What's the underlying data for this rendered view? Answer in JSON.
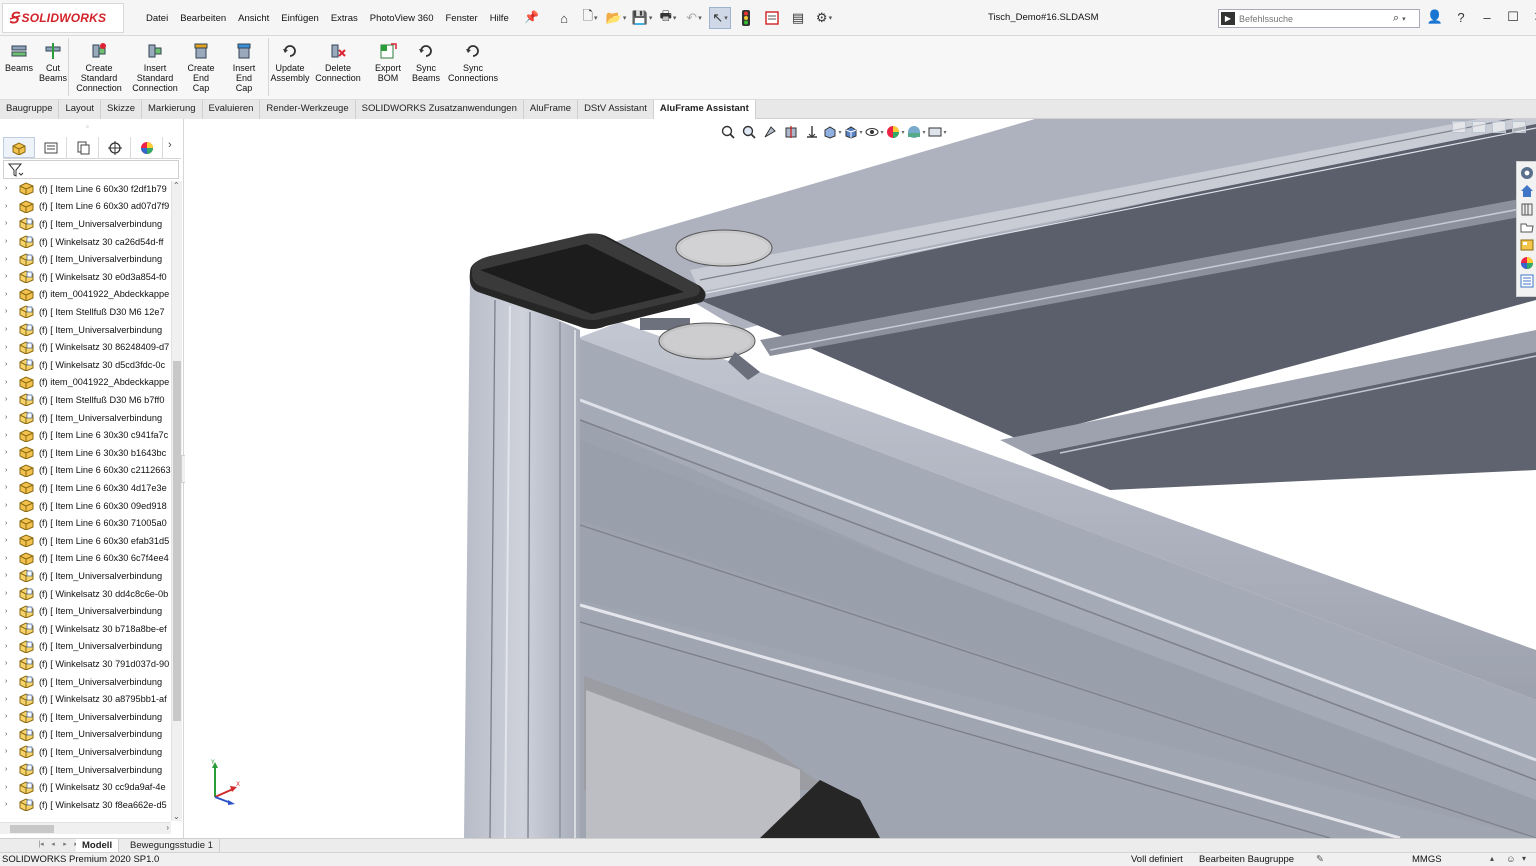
{
  "app": {
    "logo_brand": "SOLIDWORKS",
    "document_title": "Tisch_Demo#16.SLDASM"
  },
  "menu": [
    "Datei",
    "Bearbeiten",
    "Ansicht",
    "Einfügen",
    "Extras",
    "PhotoView 360",
    "Fenster",
    "Hilfe"
  ],
  "search": {
    "placeholder": "Befehlssuche"
  },
  "ribbon": [
    {
      "label": "Beams",
      "icon": "beams-icon"
    },
    {
      "label": "Cut\nBeams",
      "icon": "cut-beams-icon"
    },
    {
      "label": "Create\nStandard\nConnection",
      "icon": "create-connection-icon"
    },
    {
      "label": "Insert\nStandard\nConnection",
      "icon": "insert-connection-icon"
    },
    {
      "label": "Create\nEnd Cap",
      "icon": "create-end-cap-icon"
    },
    {
      "label": "Insert\nEnd Cap",
      "icon": "insert-end-cap-icon"
    },
    {
      "label": "Update\nAssembly",
      "icon": "update-assembly-icon"
    },
    {
      "label": "Delete\nConnection",
      "icon": "delete-connection-icon"
    },
    {
      "label": "Export\nBOM",
      "icon": "export-bom-icon"
    },
    {
      "label": "Sync\nBeams",
      "icon": "sync-beams-icon"
    },
    {
      "label": "Sync\nConnections",
      "icon": "sync-connections-icon"
    }
  ],
  "tabs": [
    {
      "label": "Baugruppe",
      "active": false
    },
    {
      "label": "Layout",
      "active": false
    },
    {
      "label": "Skizze",
      "active": false
    },
    {
      "label": "Markierung",
      "active": false
    },
    {
      "label": "Evaluieren",
      "active": false
    },
    {
      "label": "Render-Werkzeuge",
      "active": false
    },
    {
      "label": "SOLIDWORKS Zusatzanwendungen",
      "active": false
    },
    {
      "label": "AluFrame",
      "active": false
    },
    {
      "label": "DStV Assistant",
      "active": false
    },
    {
      "label": "AluFrame Assistant",
      "active": true
    }
  ],
  "tree": {
    "items": [
      {
        "label": "(f) [ Item Line 6 60x30 f2df1b79",
        "kind": "assembly"
      },
      {
        "label": "(f) [ Item Line 6 60x30 ad07d7f9",
        "kind": "assembly"
      },
      {
        "label": "(f) [ Item_Universalverbindung",
        "kind": "part"
      },
      {
        "label": "(f) [ Winkelsatz 30 ca26d54d-ff",
        "kind": "part"
      },
      {
        "label": "(f) [ Item_Universalverbindung",
        "kind": "part"
      },
      {
        "label": "(f) [ Winkelsatz 30 e0d3a854-f0",
        "kind": "part"
      },
      {
        "label": "(f) item_0041922_Abdeckkappe",
        "kind": "assembly"
      },
      {
        "label": "(f) [ Item Stellfuß D30 M6 12e7",
        "kind": "part"
      },
      {
        "label": "(f) [ Item_Universalverbindung",
        "kind": "part"
      },
      {
        "label": "(f) [ Winkelsatz 30 86248409-d7",
        "kind": "part"
      },
      {
        "label": "(f) [ Winkelsatz 30 d5cd3fdc-0c",
        "kind": "part"
      },
      {
        "label": "(f) item_0041922_Abdeckkappe",
        "kind": "assembly"
      },
      {
        "label": "(f) [ Item Stellfuß D30 M6 b7ff0",
        "kind": "part"
      },
      {
        "label": "(f) [ Item_Universalverbindung",
        "kind": "part"
      },
      {
        "label": "(f) [ Item Line 6 30x30 c941fa7c",
        "kind": "assembly"
      },
      {
        "label": "(f) [ Item Line 6 30x30 b1643bc",
        "kind": "assembly"
      },
      {
        "label": "(f) [ Item Line 6 60x30 c2112663",
        "kind": "assembly"
      },
      {
        "label": "(f) [ Item Line 6 60x30 4d17e3e",
        "kind": "assembly"
      },
      {
        "label": "(f) [ Item Line 6 60x30 09ed918",
        "kind": "assembly"
      },
      {
        "label": "(f) [ Item Line 6 60x30 71005a0",
        "kind": "assembly"
      },
      {
        "label": "(f) [ Item Line 6 60x30 efab31d5",
        "kind": "assembly"
      },
      {
        "label": "(f) [ Item Line 6 60x30 6c7f4ee4",
        "kind": "assembly"
      },
      {
        "label": "(f) [ Item_Universalverbindung",
        "kind": "part"
      },
      {
        "label": "(f) [ Winkelsatz 30 dd4c8c6e-0b",
        "kind": "part"
      },
      {
        "label": "(f) [ Item_Universalverbindung",
        "kind": "part"
      },
      {
        "label": "(f) [ Winkelsatz 30 b718a8be-ef",
        "kind": "part"
      },
      {
        "label": "(f) [ Item_Universalverbindung",
        "kind": "part"
      },
      {
        "label": "(f) [ Winkelsatz 30 791d037d-90",
        "kind": "part"
      },
      {
        "label": "(f) [ Item_Universalverbindung",
        "kind": "part"
      },
      {
        "label": "(f) [ Winkelsatz 30 a8795bb1-af",
        "kind": "part"
      },
      {
        "label": "(f) [ Item_Universalverbindung",
        "kind": "part"
      },
      {
        "label": "(f) [ Item_Universalverbindung",
        "kind": "part"
      },
      {
        "label": "(f) [ Item_Universalverbindung",
        "kind": "part"
      },
      {
        "label": "(f) [ Item_Universalverbindung",
        "kind": "part"
      },
      {
        "label": "(f) [ Winkelsatz 30 cc9da9af-4e",
        "kind": "part"
      },
      {
        "label": "(f) [ Winkelsatz 30 f8ea662e-d5",
        "kind": "part"
      }
    ]
  },
  "bottom_tabs": [
    {
      "label": "Modell",
      "active": true
    },
    {
      "label": "Bewegungsstudie 1",
      "active": false
    }
  ],
  "status": {
    "product": "SOLIDWORKS Premium 2020 SP1.0",
    "definition": "Voll definiert",
    "mode": "Bearbeiten Baugruppe",
    "units": "MMGS"
  },
  "colors": {
    "brand_red": "#d2232a",
    "profile_aluminium": "#a9aebb",
    "end_cap": "#1f1f1f"
  }
}
